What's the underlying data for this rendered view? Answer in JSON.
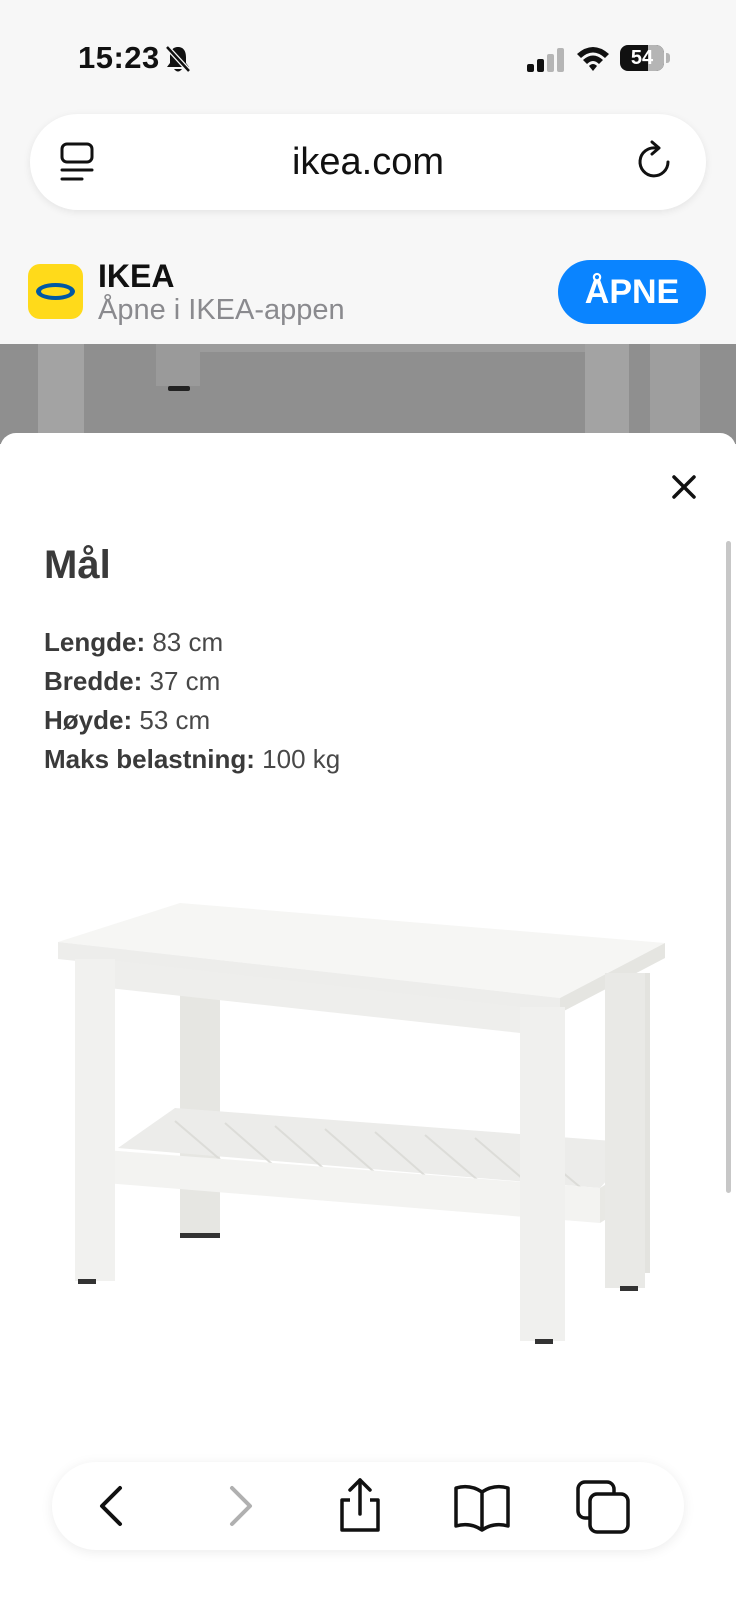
{
  "status_bar": {
    "time": "15:23",
    "battery": "54"
  },
  "browser": {
    "address": "ikea.com"
  },
  "app_banner": {
    "name": "IKEA",
    "subtitle": "Åpne i IKEA-appen",
    "open_label": "ÅPNE"
  },
  "sheet": {
    "title": "Mål",
    "dimensions": [
      {
        "label": "Lengde:",
        "value": "83 cm"
      },
      {
        "label": "Bredde:",
        "value": "37 cm"
      },
      {
        "label": "Høyde:",
        "value": "53 cm"
      },
      {
        "label": "Maks belastning:",
        "value": "100 kg"
      }
    ]
  },
  "colors": {
    "accent": "#0a84ff",
    "ikea_yellow": "#ffda1a",
    "ikea_blue": "#0058a3"
  }
}
